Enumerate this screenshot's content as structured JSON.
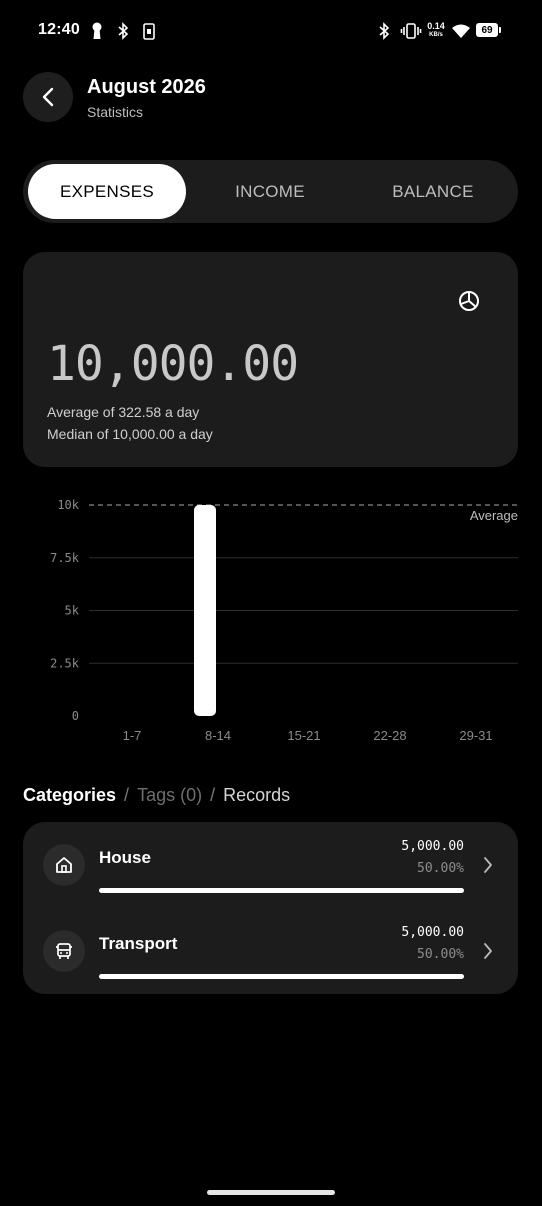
{
  "status_bar": {
    "time": "12:40",
    "net_speed_value": "0.14",
    "net_speed_unit": "KB/s",
    "battery": "69",
    "icons": [
      "keyhole-icon",
      "bluetooth-icon",
      "sim-icon",
      "bluetooth-icon",
      "vibrate-icon",
      "wifi-icon",
      "battery-icon"
    ]
  },
  "header": {
    "title": "August 2026",
    "subtitle": "Statistics"
  },
  "tabs": [
    {
      "label": "EXPENSES",
      "active": true
    },
    {
      "label": "INCOME",
      "active": false
    },
    {
      "label": "BALANCE",
      "active": false
    }
  ],
  "summary": {
    "amount": "10,000.00",
    "average_text": "Average of 322.58 a day",
    "median_text": "Median of 10,000.00 a day"
  },
  "chart_data": {
    "type": "bar",
    "categories": [
      "1-7",
      "8-14",
      "15-21",
      "22-28",
      "29-31"
    ],
    "values": [
      0,
      10000,
      0,
      0,
      0
    ],
    "y_ticks": [
      0,
      2500,
      5000,
      7500,
      10000
    ],
    "y_tick_labels": [
      "0",
      "2.5k",
      "5k",
      "7.5k",
      "10k"
    ],
    "ylim": [
      0,
      10000
    ],
    "reference_line": {
      "label": "Average",
      "value": 10000
    },
    "grid": true,
    "colors": {
      "bar": "#ffffff",
      "grid": "#2e2e2e",
      "tick": "#8a8a8a"
    }
  },
  "sections": {
    "categories": "Categories",
    "tags": "Tags (0)",
    "records": "Records",
    "separator": "/"
  },
  "categories": [
    {
      "name": "House",
      "icon": "house-icon",
      "amount": "5,000.00",
      "percent": "50.00%",
      "fraction": 1.0
    },
    {
      "name": "Transport",
      "icon": "bus-icon",
      "amount": "5,000.00",
      "percent": "50.00%",
      "fraction": 1.0
    }
  ],
  "colors": {
    "background": "#000000",
    "surface": "#1c1c1c",
    "accent": "#ffffff"
  }
}
